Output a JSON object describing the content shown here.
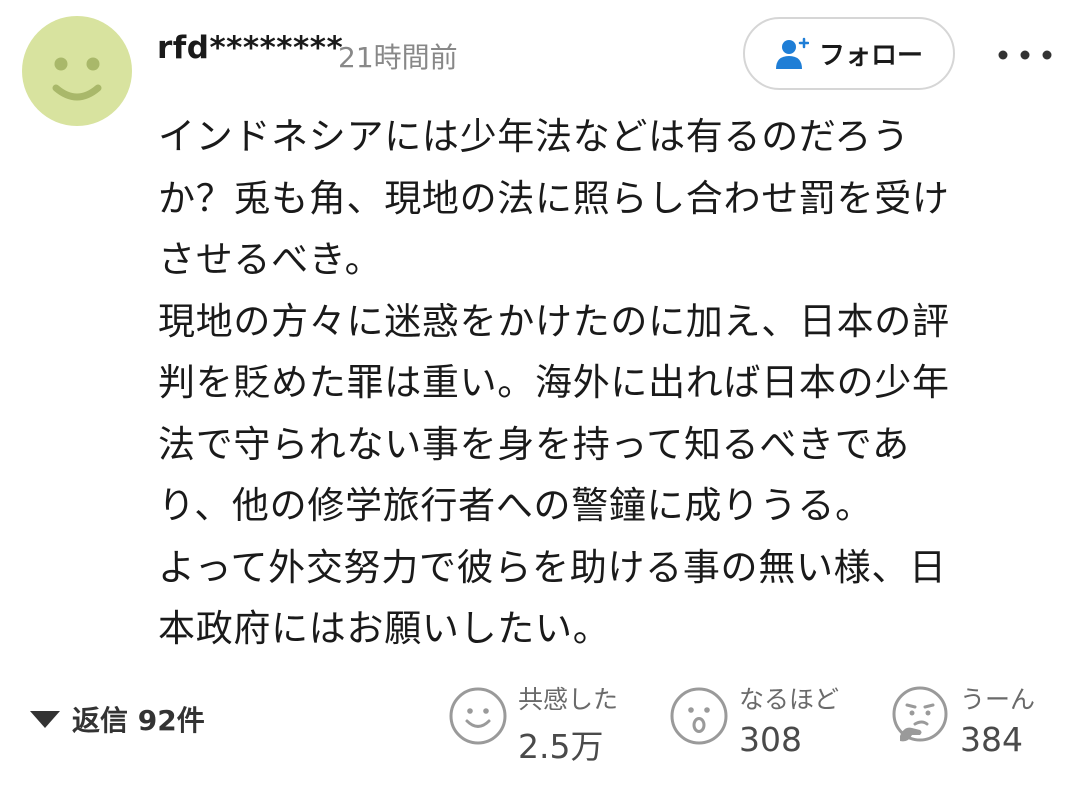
{
  "comment": {
    "username": "rfd********",
    "timestamp": "21時間前",
    "follow_label": "フォロー",
    "body_lines": [
      "インドネシアには少年法などは有るのだろう",
      "か？兎も角、現地の法に照らし合わせ罰を受け",
      "させるべき。",
      "現地の方々に迷惑をかけたのに加え、日本の評",
      "判を貶めた罪は重い。海外に出れば日本の少年",
      "法で守られない事を身を持って知るべきであ",
      "り、他の修学旅行者への警鐘に成りうる。",
      "よって外交努力で彼らを助ける事の無い様、日",
      "本政府にはお願いしたい。"
    ]
  },
  "replies": {
    "label": "返信 92件"
  },
  "reactions": [
    {
      "label": "共感した",
      "count": "2.5万",
      "icon": "smile-face-icon"
    },
    {
      "label": "なるほど",
      "count": "308",
      "icon": "surprised-face-icon"
    },
    {
      "label": "うーん",
      "count": "384",
      "icon": "thinking-face-icon"
    }
  ],
  "colors": {
    "avatar_bg": "#d8e39f",
    "avatar_face": "#a9b86a",
    "follow_icon": "#1f7ed6",
    "text": "#1a1a1a",
    "muted": "#888888"
  }
}
